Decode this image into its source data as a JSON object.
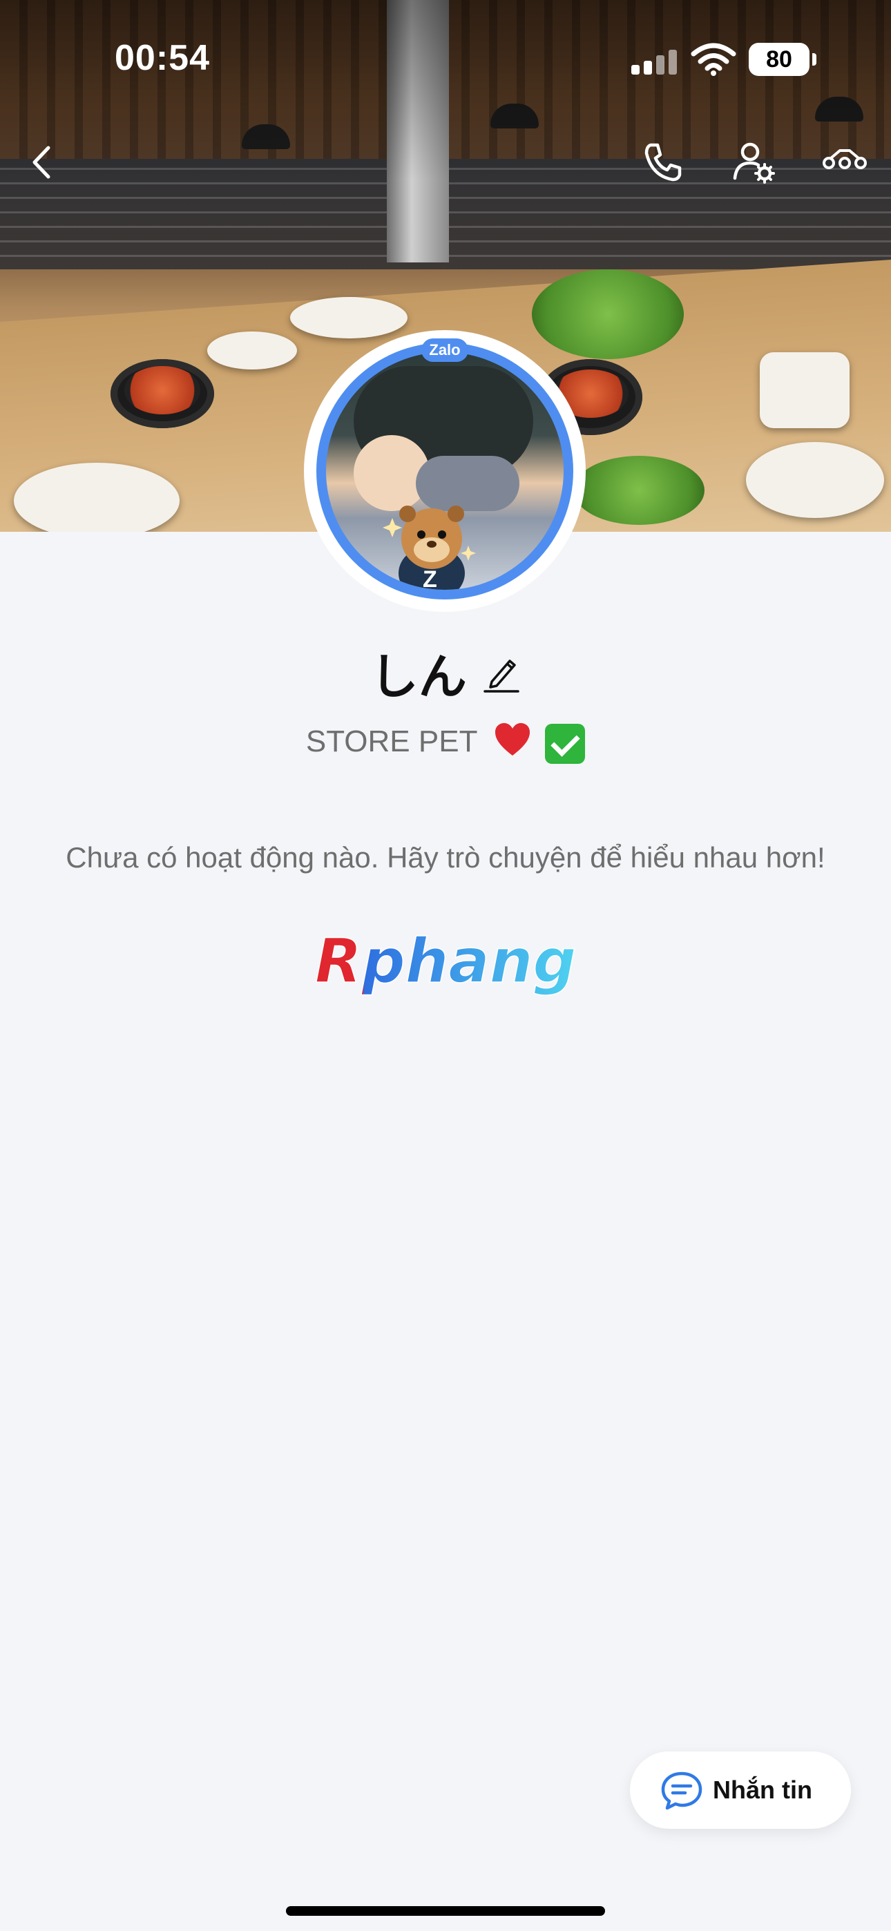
{
  "status_bar": {
    "time": "00:54",
    "battery": "80"
  },
  "nav": {
    "icons": [
      "back-icon",
      "phone-icon",
      "user-settings-icon",
      "more-icon"
    ]
  },
  "avatar": {
    "badge": "Zalo",
    "ring_color": "#4f8ef0"
  },
  "profile": {
    "name": "しん",
    "bio": "STORE PET"
  },
  "timeline": {
    "empty_message": "Chưa có hoạt động nào. Hãy trò chuyện để hiểu nhau hơn!"
  },
  "logo": {
    "text": "Rphang"
  },
  "actions": {
    "message_label": "Nhắn tin"
  },
  "colors": {
    "accent": "#4f8ef0",
    "background": "#f3f5f8"
  }
}
